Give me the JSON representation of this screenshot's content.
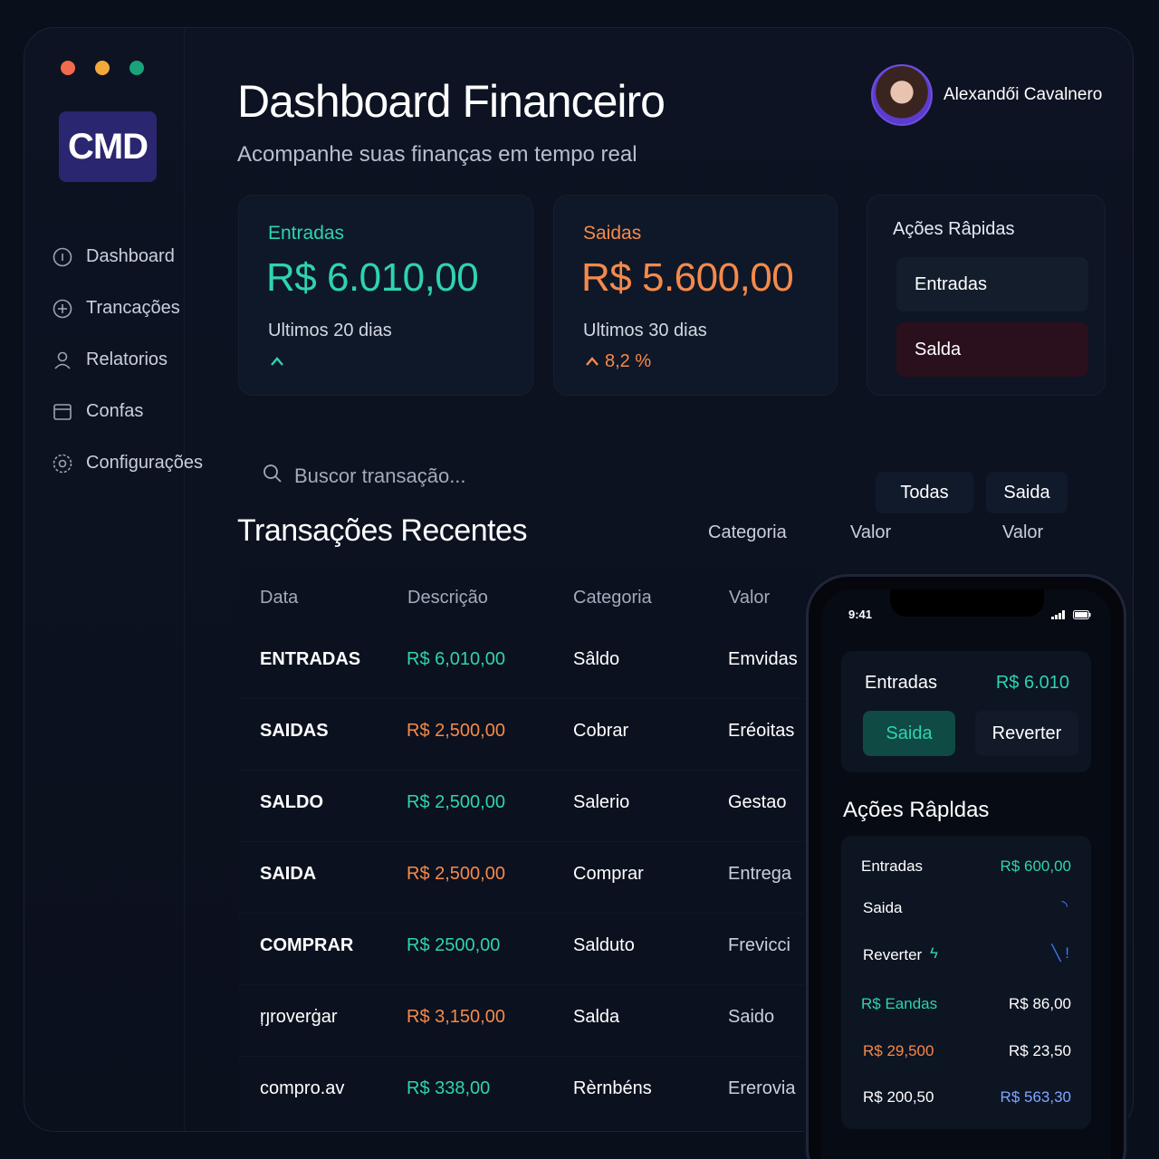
{
  "colors": {
    "accent_green": "#2fd3b0",
    "accent_orange": "#f58a4b",
    "traffic_red": "#f26b4a",
    "traffic_yellow": "#f2a93b",
    "traffic_green": "#1aa37a",
    "logo_bg": "#2a2670",
    "saida_button": "#2a0f1d",
    "phone_saida_button": "#0f4a45"
  },
  "logo": "CMD",
  "sidebar": {
    "items": [
      {
        "label": "Dashboard",
        "icon": "info-circle-icon"
      },
      {
        "label": "Trancações",
        "icon": "plus-circle-icon"
      },
      {
        "label": "Relatorios",
        "icon": "user-icon"
      },
      {
        "label": "Confas",
        "icon": "card-icon"
      },
      {
        "label": "Configurações",
        "icon": "settings-icon"
      }
    ]
  },
  "header": {
    "title": "Dashboard Financeiro",
    "subtitle": "Acompanhe suas finanças em tempo real",
    "user_name": "Alexandői Cavalnero"
  },
  "cards": {
    "entradas": {
      "label": "Entradas",
      "value": "R$ 6.010,00",
      "period": "Ultimos 20 dias",
      "trend": ""
    },
    "saidas": {
      "label": "Saidas",
      "value": "R$ 5.600,00",
      "period": "Ultimos 30 dias",
      "trend": "8,2 %"
    }
  },
  "quick_actions": {
    "title": "Ações Râpidas",
    "entradas": "Entradas",
    "saida": "Salda"
  },
  "search": {
    "placeholder": "Buscor transação..."
  },
  "filters": [
    "Todas",
    "Saida"
  ],
  "transactions": {
    "title": "Transações Recentes",
    "section_cols": [
      "Categoria",
      "Valor",
      "Valor"
    ],
    "headers": [
      "Data",
      "Descrição",
      "Categoria",
      "Valor"
    ],
    "rows": [
      {
        "data": "ENTRADAS",
        "descricao": "R$ 6,010,00",
        "categoria": "Sâldo",
        "valor": "Emvidas",
        "tone": "green"
      },
      {
        "data": "SAIDAS",
        "descricao": "R$ 2,500,00",
        "categoria": "Cobrar",
        "valor": "Eréoitas",
        "tone": "orange"
      },
      {
        "data": "SALDO",
        "descricao": "R$ 2,500,00",
        "categoria": "Salerio",
        "valor": "Gestao",
        "tone": "green"
      },
      {
        "data": "SAIDA",
        "descricao": "R$ 2,500,00",
        "categoria": "Comprar",
        "valor": "Entrega",
        "tone": "orange"
      },
      {
        "data": "COMPRAR",
        "descricao": "R$ 2500,00",
        "categoria": "Salduto",
        "valor": "Frevicci",
        "tone": "green"
      },
      {
        "data": "ŗȷroverġar",
        "descricao": "R$ 3,150,00",
        "categoria": "Salda",
        "valor": "Saido",
        "tone": "orange"
      },
      {
        "data": "compro.av",
        "descricao": "R$ 338,00",
        "categoria": "Rèrnbéns",
        "valor": "Ererovia",
        "tone": "green"
      }
    ]
  },
  "phone": {
    "time": "9:41",
    "top_card": {
      "label": "Entradas",
      "value": "R$ 6.010",
      "btn_saida": "Saida",
      "btn_reverter": "Reverter"
    },
    "quick_title": "Ações Râpldas",
    "list": [
      {
        "left": "Entradas",
        "right": "R$ 600,00",
        "left_tone": "white",
        "right_tone": "green"
      },
      {
        "left": "Saida",
        "right": "",
        "left_tone": "white",
        "right_tone": "blue"
      },
      {
        "left": "Reverter",
        "right": "",
        "left_tone": "white",
        "right_tone": "blue"
      },
      {
        "left": "R$ Eandas",
        "right": "R$ 86,00",
        "left_tone": "green",
        "right_tone": "white"
      },
      {
        "left": "R$ 29,500",
        "right": "R$ 23,50",
        "left_tone": "orange",
        "right_tone": "white"
      },
      {
        "left": "R$ 200,50",
        "right": "R$ 563,30",
        "left_tone": "white",
        "right_tone": "blue"
      }
    ]
  }
}
